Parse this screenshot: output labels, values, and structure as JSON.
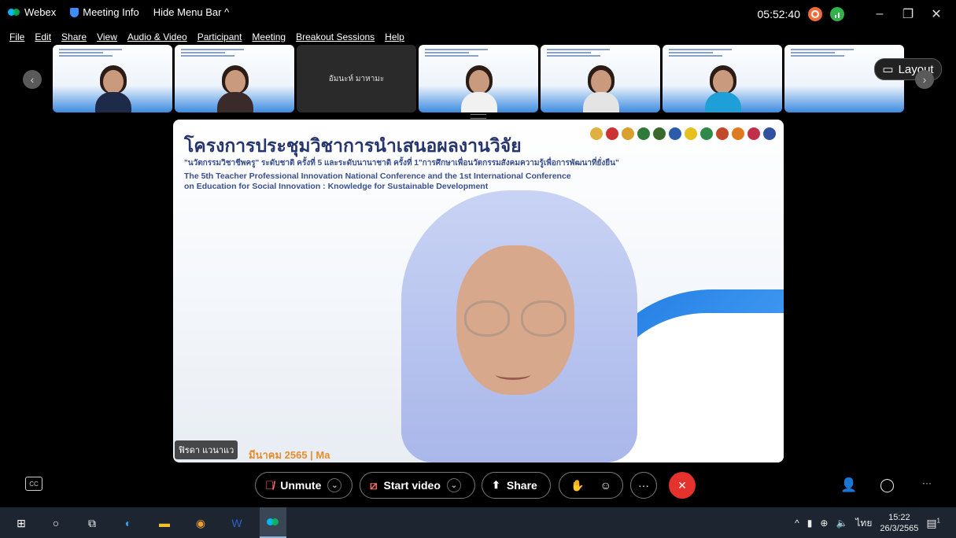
{
  "titlebar": {
    "app_name": "Webex",
    "meeting_info": "Meeting Info",
    "hide_menu": "Hide Menu Bar ^",
    "time": "05:52:40",
    "minimize": "–",
    "restore": "❐",
    "close": "✕"
  },
  "menu": {
    "items": [
      "File",
      "Edit",
      "Share",
      "View",
      "Audio & Video",
      "Participant",
      "Meeting",
      "Breakout Sessions",
      "Help"
    ]
  },
  "thumbnails": {
    "no_video_name": "อัมนะห์ มาหามะ"
  },
  "layout_button": {
    "label": "Layout"
  },
  "stage": {
    "title": "โครงการประชุมวิชาการนำเสนอผลงานวิจัย",
    "subtitle_th": "\"นวัตกรรมวิชาชีพครู\" ระดับชาติ ครั้งที่ 5 และระดับนานาชาติ ครั้งที่ 1\"การศึกษาเพื่อนวัตกรรมสังคมความรู้เพื่อการพัฒนาที่ยั่งยืน\"",
    "subtitle_en_1": "The 5th Teacher Professional Innovation National Conference and the 1st International Conference",
    "subtitle_en_2": "on Education for Social Innovation : Knowledge for Sustainable Development",
    "speaker_name": "ฟิรดา แวนาแว",
    "date_text": "มีนาคม  2565 | Ma"
  },
  "controls": {
    "cc": "CC",
    "unmute": "Unmute",
    "start_video": "Start video",
    "share": "Share",
    "more": "···",
    "end": "✕",
    "overflow": "···"
  },
  "taskbar": {
    "lang": "ไทย",
    "time": "15:22",
    "date": "26/3/2565",
    "notif_count": "1"
  },
  "colors": {
    "accent_blue": "#1f7be2",
    "end_call_red": "#e5322d",
    "record_orange": "#f26b3a",
    "signal_green": "#2fb34a"
  }
}
